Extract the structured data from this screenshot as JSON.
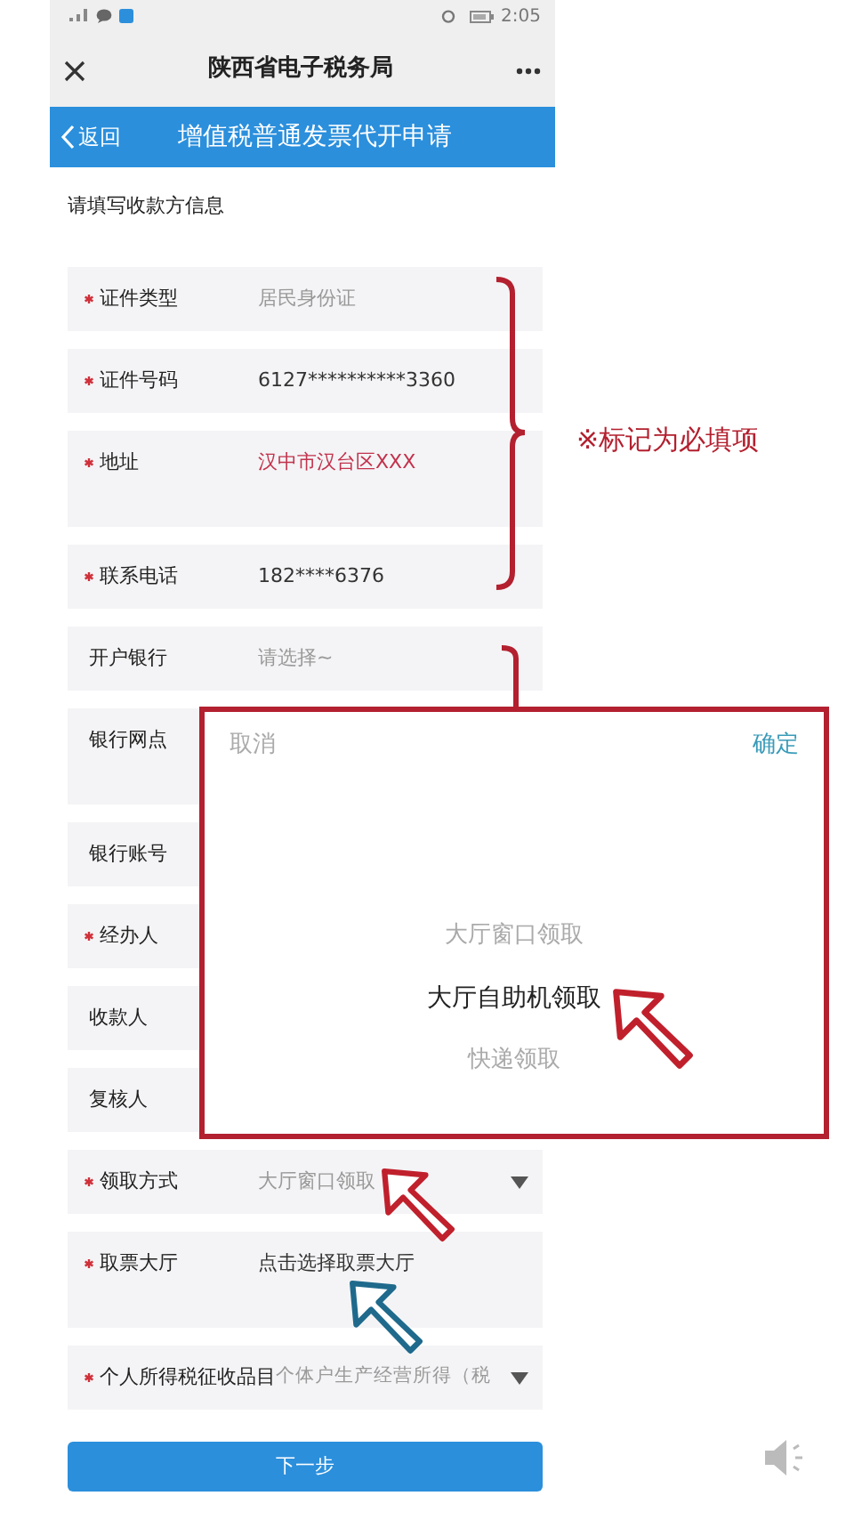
{
  "status_bar": {
    "time": "2:05"
  },
  "title_bar": {
    "title": "陕西省电子税务局"
  },
  "header": {
    "back": "返回",
    "title": "增值税普通发票代开申请"
  },
  "section_title": "请填写收款方信息",
  "fields": [
    {
      "label": "证件类型",
      "required": true,
      "kind": "text",
      "placeholder": "居民身份证"
    },
    {
      "label": "证件号码",
      "required": true,
      "kind": "text",
      "value": "6127**********3360"
    },
    {
      "label": "地址",
      "required": true,
      "kind": "textarea",
      "value": "汉中市汉台区XXX",
      "color": "#c2334d"
    },
    {
      "label": "联系电话",
      "required": true,
      "kind": "text",
      "value": "182****6376"
    },
    {
      "label": "开户银行",
      "required": false,
      "kind": "text",
      "placeholder": "请选择~"
    },
    {
      "label": "银行网点",
      "required": false,
      "kind": "textarea"
    },
    {
      "label": "银行账号",
      "required": false,
      "kind": "text"
    },
    {
      "label": "经办人",
      "required": true,
      "kind": "text"
    },
    {
      "label": "收款人",
      "required": false,
      "kind": "text"
    },
    {
      "label": "复核人",
      "required": false,
      "kind": "text"
    },
    {
      "label": "领取方式",
      "required": true,
      "kind": "select",
      "placeholder": "大厅窗口领取"
    },
    {
      "label": "取票大厅",
      "required": true,
      "kind": "textarea",
      "value": "点击选择取票大厅"
    },
    {
      "label": "个人所得税征收品目",
      "required": true,
      "kind": "select",
      "placeholder": "个体户生产经营所得（税"
    }
  ],
  "submit": "下一步",
  "annotation": {
    "note": "※标记为必填项"
  },
  "picker": {
    "cancel": "取消",
    "confirm": "确定",
    "options": [
      {
        "label": "大厅窗口领取",
        "selected": false
      },
      {
        "label": "大厅自助机领取",
        "selected": true
      },
      {
        "label": "快递领取",
        "selected": false
      }
    ]
  }
}
